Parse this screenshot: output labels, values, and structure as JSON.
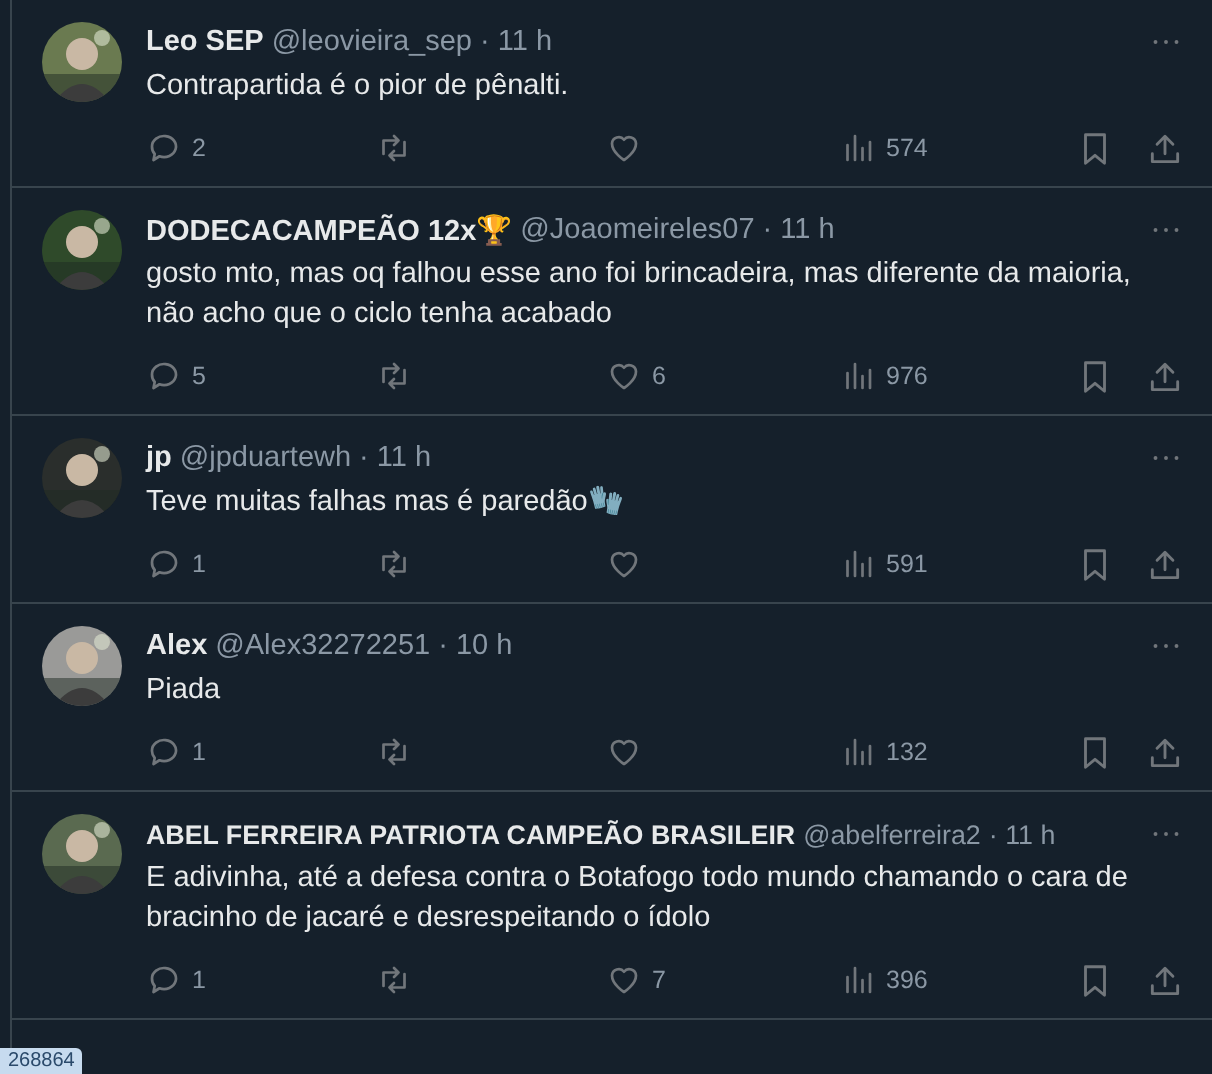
{
  "tweets": [
    {
      "name": "Leo SEP",
      "handle": "@leovieira_sep",
      "time": "· 11 h",
      "text": "Contrapartida é o pior de pênalti.",
      "replies": "2",
      "views": "574"
    },
    {
      "name": "DODECACAMPEÃO 12x🏆",
      "handle": "@Joaomeireles07",
      "time": "· 11 h",
      "text": "gosto mto, mas oq falhou esse ano foi brincadeira, mas diferente da maioria, não acho que o ciclo tenha acabado",
      "replies": "5",
      "likes": "6",
      "views": "976"
    },
    {
      "name": "jp",
      "handle": "@jpduartewh",
      "time": "· 11 h",
      "text": "Teve muitas falhas mas é paredão🧤",
      "replies": "1",
      "views": "591"
    },
    {
      "name": "Alex",
      "handle": "@Alex32272251",
      "time": "· 10 h",
      "text": "Piada",
      "replies": "1",
      "views": "132"
    },
    {
      "name": "ABEL FERREIRA PATRIOTA CAMPEÃO BRASILEIR",
      "handle": "@abelferreira2",
      "time": "· 11 h",
      "text": "E adivinha, até a defesa contra o Botafogo todo mundo chamando o cara de bracinho de jacaré e desrespeitando o ídolo",
      "replies": "1",
      "likes": "7",
      "views": "396"
    }
  ],
  "corner_tag": "268864"
}
